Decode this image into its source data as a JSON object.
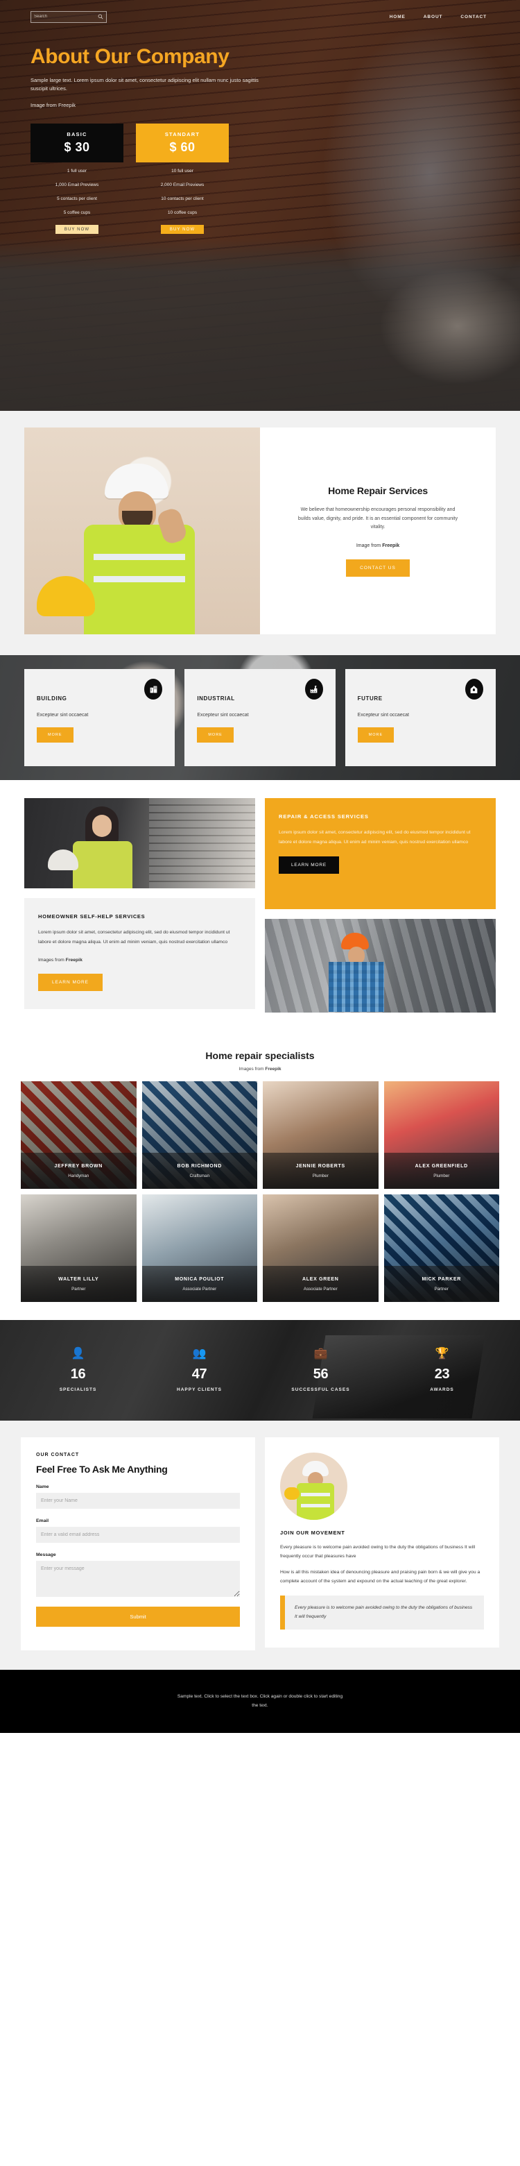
{
  "header": {
    "search": {
      "placeholder": "Search",
      "value": "",
      "icon": "search-icon"
    },
    "nav": [
      {
        "label": "HOME"
      },
      {
        "label": "ABOUT"
      },
      {
        "label": "CONTACT"
      }
    ]
  },
  "hero": {
    "title": "About Our Company",
    "subtitle": "Sample large text. Lorem ipsum dolor sit amet, consectetur adipiscing elit nullam nunc justo sagittis suscipit ultrices.",
    "credit": "Image from Freepik",
    "plans": [
      {
        "name": "BASIC",
        "price": "$ 30",
        "style": "basic",
        "features": [
          "1 full user",
          "1,000 Email Previews",
          "5 contacts per client",
          "5 coffee cups"
        ],
        "button": "BUY NOW"
      },
      {
        "name": "STANDART",
        "price": "$ 60",
        "style": "standart",
        "features": [
          "10 full user",
          "2,000 Email Previews",
          "10 contacts per client",
          "10 coffee cups"
        ],
        "button": "BUY NOW"
      }
    ]
  },
  "services": {
    "title": "Home Repair Services",
    "body": "We believe that homeownership encourages personal responsibility and builds value, dignity, and pride. It is an essential component for community vitality.",
    "credit_prefix": "Image from ",
    "credit_brand": "Freepik",
    "button": "CONTACT US"
  },
  "feature_cards": [
    {
      "title": "BUILDING",
      "desc": "Excepteur sint occaecat",
      "button": "MORE",
      "icon": "office-building-icon"
    },
    {
      "title": "INDUSTRIAL",
      "desc": "Excepteur sint occaecat",
      "button": "MORE",
      "icon": "factory-icon"
    },
    {
      "title": "FUTURE",
      "desc": "Excepteur sint occaecat",
      "button": "MORE",
      "icon": "gas-flame-home-icon"
    }
  ],
  "repair": {
    "amber_panel": {
      "title": "REPAIR & ACCESS SERVICES",
      "body": "Lorem ipsum dolor sit amet, consectetur adipiscing elit, sed do eiusmod tempor incididunt ut labore et dolore magna aliqua. Ut enim ad minim veniam, quis nostrud exercitation ullamco",
      "button": "LEARN MORE"
    },
    "gray_panel": {
      "title": "HOMEOWNER SELF-HELP SERVICES",
      "body": "Lorem ipsum dolor sit amet, consectetur adipiscing elit, sed do eiusmod tempor incididunt ut labore et dolore magna aliqua. Ut enim ad minim veniam, quis nostrud exercitation ullamco",
      "credit_prefix": "Images from ",
      "credit_brand": "Freepik",
      "button": "LEARN MORE"
    }
  },
  "specialists": {
    "title": "Home repair specialists",
    "credit_prefix": "Images from ",
    "credit_brand": "Freepik",
    "people": [
      {
        "name": "JEFFREY BROWN",
        "role": "Handyman"
      },
      {
        "name": "BOB RICHMOND",
        "role": "Craftsman"
      },
      {
        "name": "JENNIE ROBERTS",
        "role": "Plumber"
      },
      {
        "name": "ALEX GREENFIELD",
        "role": "Plumber"
      },
      {
        "name": "WALTER LILLY",
        "role": "Partner"
      },
      {
        "name": "MONICA POULIOT",
        "role": "Associate Partner"
      },
      {
        "name": "ALEX GREEN",
        "role": "Associate Partner"
      },
      {
        "name": "MICK PARKER",
        "role": "Partner"
      }
    ]
  },
  "stats": [
    {
      "value": "16",
      "label": "SPECIALISTS",
      "icon": "person-badge-icon"
    },
    {
      "value": "47",
      "label": "HAPPY CLIENTS",
      "icon": "people-group-icon"
    },
    {
      "value": "56",
      "label": "SUCCESSFUL CASES",
      "icon": "briefcase-icon"
    },
    {
      "value": "23",
      "label": "AWARDS",
      "icon": "trophy-icon"
    }
  ],
  "contact": {
    "eyebrow": "OUR CONTACT",
    "title": "Feel Free To Ask Me Anything",
    "fields": {
      "name": {
        "label": "Name",
        "placeholder": "Enter your Name",
        "value": ""
      },
      "email": {
        "label": "Email",
        "placeholder": "Enter a valid email address",
        "value": ""
      },
      "message": {
        "label": "Message",
        "placeholder": "Enter your message",
        "value": ""
      }
    },
    "submit": "Submit"
  },
  "join": {
    "title": "JOIN OUR MOVEMENT",
    "paragraph1": "Every pleasure is to welcome pain avoided owing to the duty the obligations of business It will frequently occur that pleasures have",
    "paragraph2": "How is all this mistaken idea of denouncing pleasure and praising pain born & we will give you a complete account of the system and expound on the actual teaching of the great explorer.",
    "quote": "Every pleasure is to welcome pain avoided owing to the duty the obligations of business It will frequently"
  },
  "footer": {
    "text": "Sample text. Click to select the text box. Click again or double click to start editing the text."
  },
  "colors": {
    "amber": "#F2A81D",
    "amber_light": "#F5AE1B",
    "dark": "#0a0a0a",
    "panel_gray": "#f2f2f2"
  }
}
